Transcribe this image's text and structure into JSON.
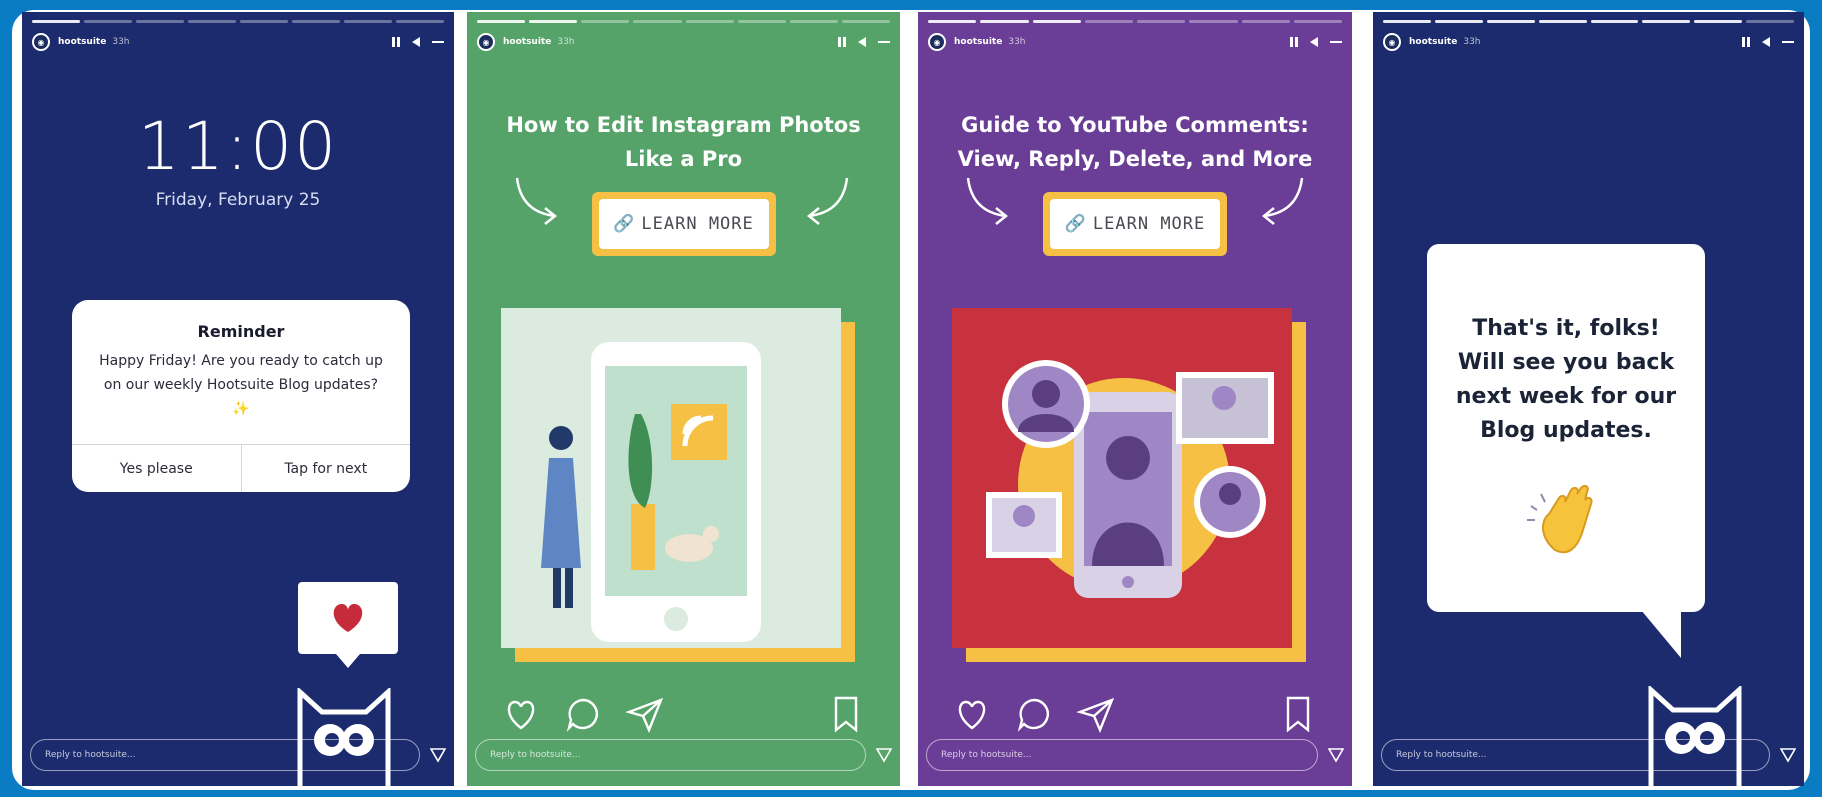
{
  "stories": [
    {
      "username": "hootsuite",
      "time": "33h",
      "clock": "11:00",
      "date": "Friday, February 25",
      "notification": {
        "title": "Reminder",
        "body": "Happy Friday! Are you ready to catch up on our weekly Hootsuite Blog updates? ✨",
        "action_yes": "Yes please",
        "action_next": "Tap for next"
      },
      "reply_placeholder": "Reply to hootsuite..."
    },
    {
      "username": "hootsuite",
      "time": "33h",
      "title_line1": "How to Edit Instagram Photos",
      "title_line2": "Like a Pro",
      "learn_more": "LEARN MORE",
      "reply_placeholder": "Reply to hootsuite..."
    },
    {
      "username": "hootsuite",
      "time": "33h",
      "title_line1": "Guide to YouTube Comments:",
      "title_line2": "View, Reply, Delete, and More",
      "learn_more": "LEARN MORE",
      "reply_placeholder": "Reply to hootsuite..."
    },
    {
      "username": "hootsuite",
      "time": "33h",
      "message_line1": "That's it, folks!",
      "message_line2": "Will see you back",
      "message_line3": "next week for our",
      "message_line4": "Blog updates.",
      "reply_placeholder": "Reply to hootsuite..."
    }
  ],
  "colors": {
    "background": "#0a7cc4",
    "navy": "#1b2b6e",
    "green": "#56a36a",
    "purple": "#6a3d96",
    "yellow": "#f5c043",
    "heart": "#c62b3b"
  }
}
